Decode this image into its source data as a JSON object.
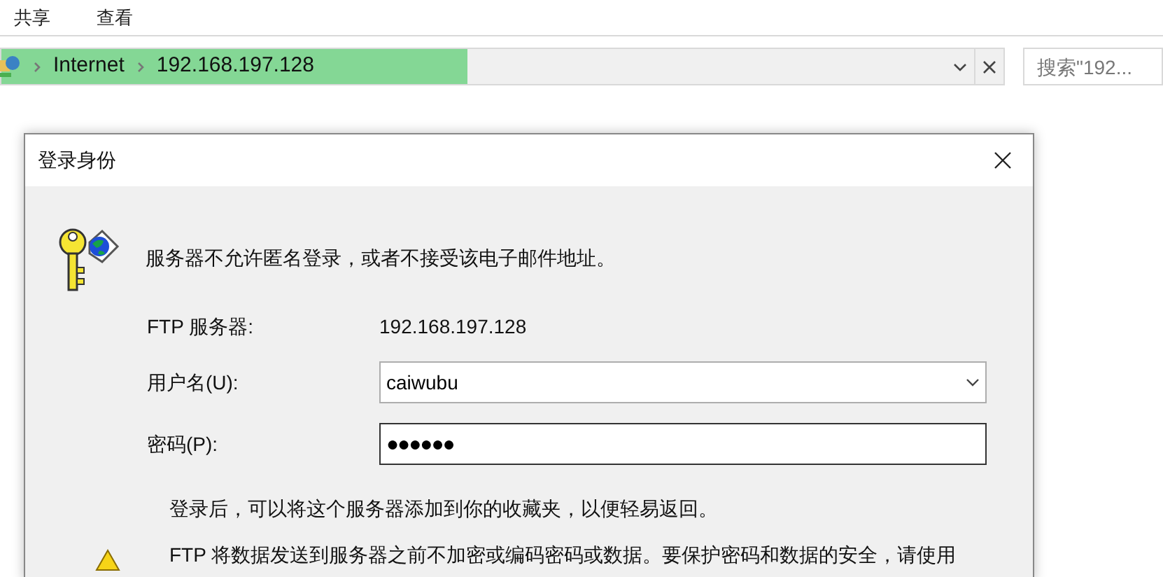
{
  "ribbon_tabs": [
    {
      "label": "共享"
    },
    {
      "label": "查看"
    }
  ],
  "address_bar": {
    "breadcrumbs": [
      "Internet",
      "192.168.197.128"
    ],
    "level": 0.48
  },
  "search": {
    "placeholder": "搜索\"192..."
  },
  "dialog": {
    "title": "登录身份",
    "message": "服务器不允许匿名登录，或者不接受该电子邮件地址。",
    "fields": [
      {
        "kind": "static",
        "label": "FTP 服务器:",
        "value": "192.168.197.128"
      },
      {
        "kind": "combo",
        "label": "用户名(U):",
        "value": "caiwubu"
      },
      {
        "kind": "password",
        "label": "密码(P):",
        "value": "●●●●●●"
      }
    ],
    "note": "登录后，可以将这个服务器添加到你的收藏夹，以便轻易返回。",
    "warning": "FTP 将数据发送到服务器之前不加密或编码密码或数据。要保护密码和数据的安全，请使用"
  }
}
